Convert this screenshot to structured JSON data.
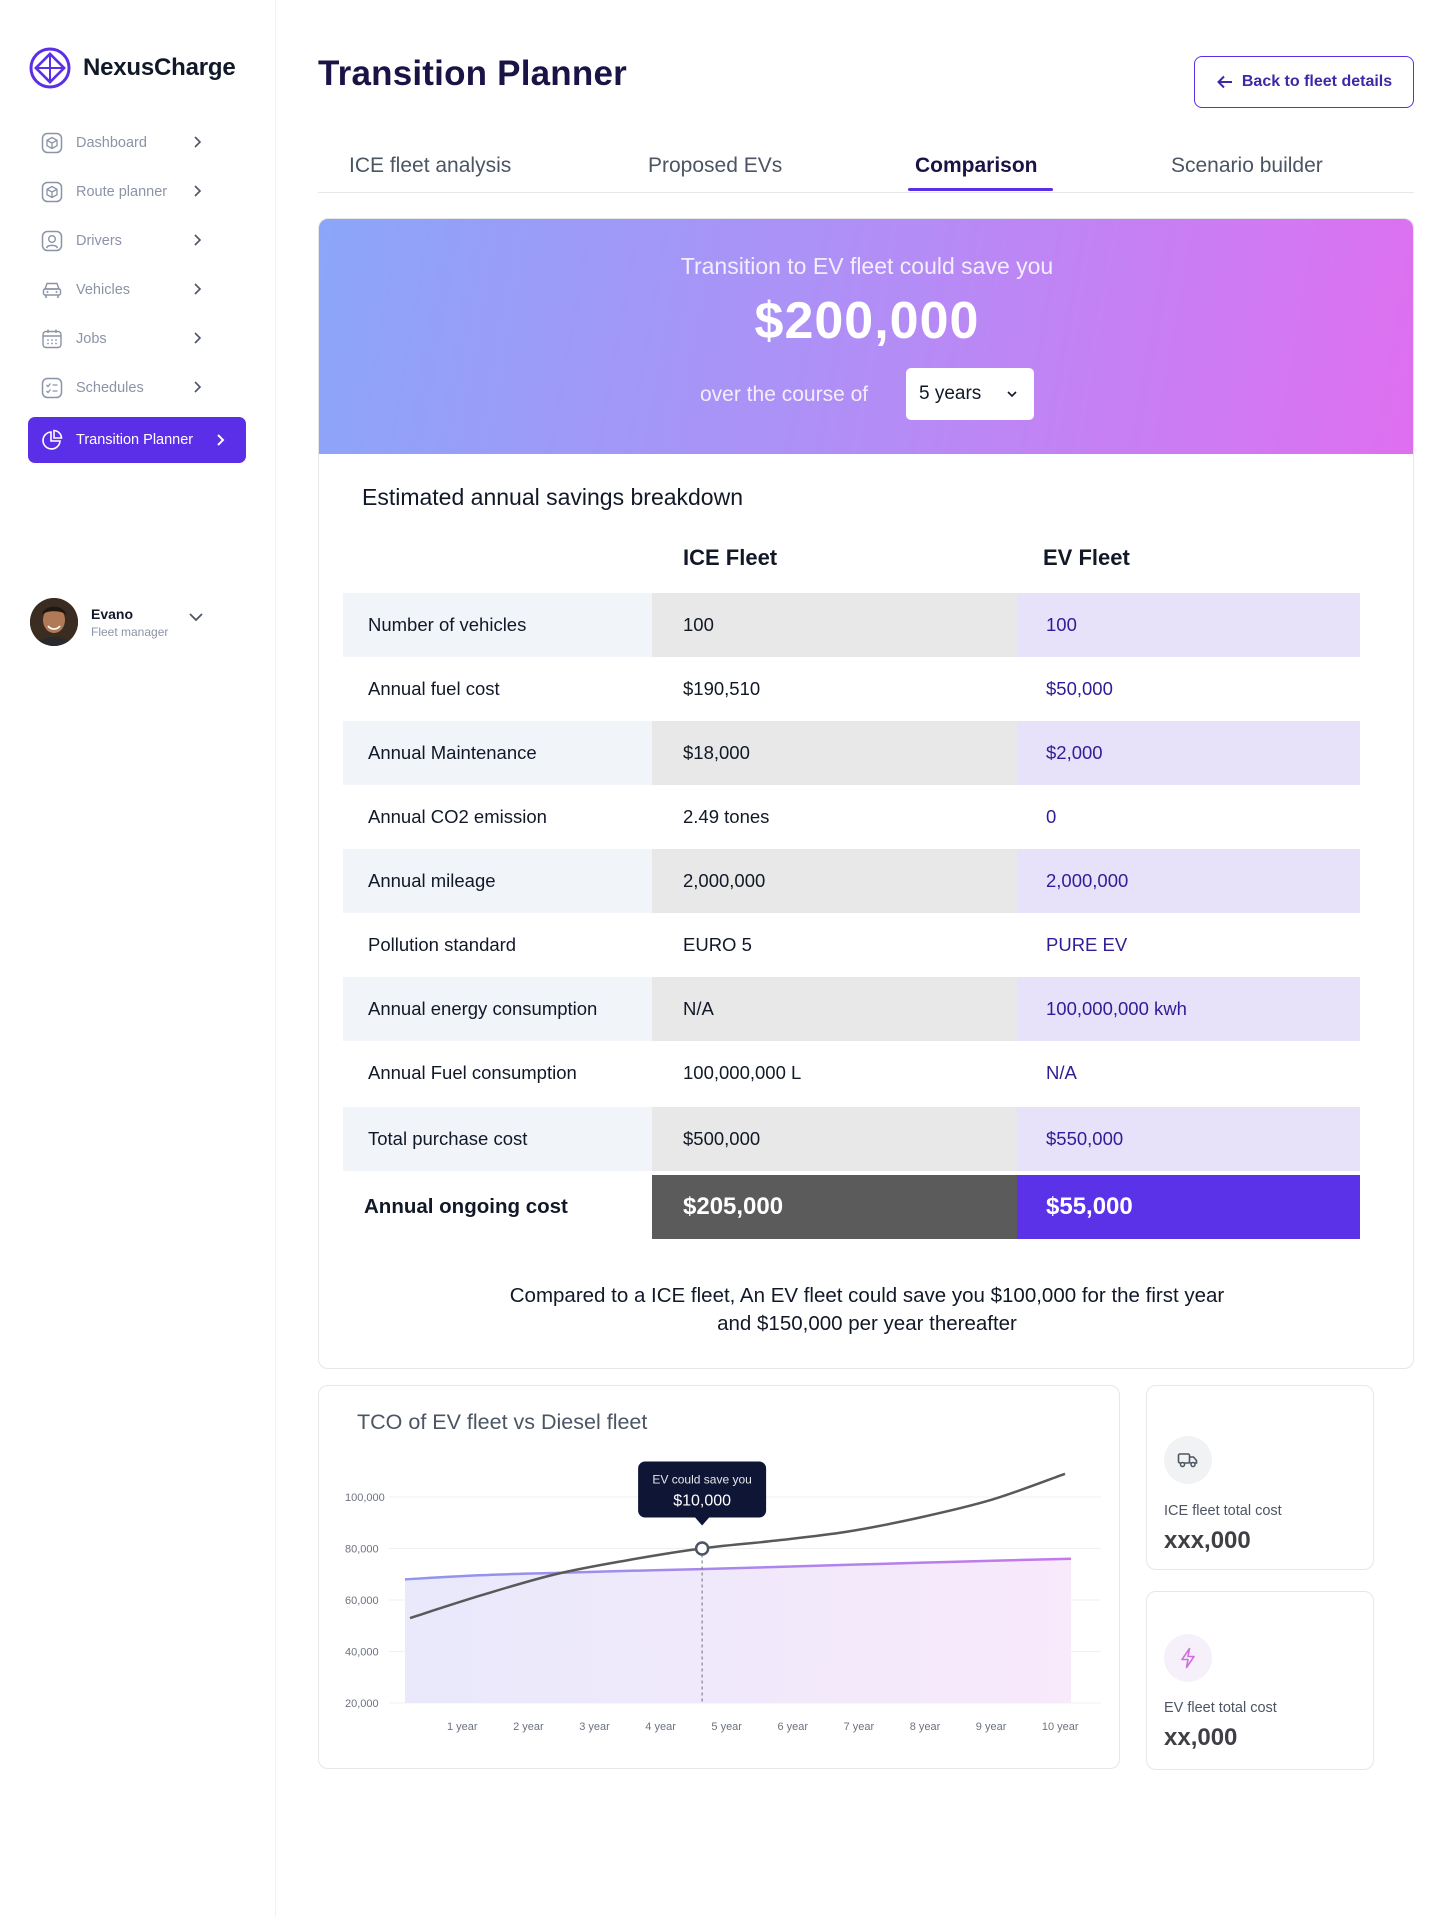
{
  "brand": {
    "name": "NexusCharge"
  },
  "sidebar": {
    "items": [
      {
        "label": "Dashboard",
        "icon": "cube-icon"
      },
      {
        "label": "Route planner",
        "icon": "route-icon"
      },
      {
        "label": "Drivers",
        "icon": "driver-icon"
      },
      {
        "label": "Vehicles",
        "icon": "car-icon"
      },
      {
        "label": "Jobs",
        "icon": "calendar-icon"
      },
      {
        "label": "Schedules",
        "icon": "schedule-icon"
      },
      {
        "label": "Transition Planner",
        "icon": "pie-chart-icon",
        "active": true
      }
    ]
  },
  "user": {
    "name": "Evano",
    "role": "Fleet manager"
  },
  "page": {
    "title": "Transition Planner",
    "back_label": "Back to fleet details"
  },
  "tabs": [
    {
      "label": "ICE fleet analysis"
    },
    {
      "label": "Proposed EVs"
    },
    {
      "label": "Comparison",
      "active": true
    },
    {
      "label": "Scenario builder"
    }
  ],
  "hero": {
    "subtitle": "Transition to EV fleet could save you",
    "amount": "$200,000",
    "course_label": "over the course of",
    "period": "5 years"
  },
  "breakdown": {
    "title": "Estimated annual savings breakdown",
    "col_ice": "ICE Fleet",
    "col_ev": "EV Fleet",
    "rows": [
      {
        "label": "Number of vehicles",
        "ice": "100",
        "ev": "100"
      },
      {
        "label": "Annual fuel cost",
        "ice": "$190,510",
        "ev": "$50,000"
      },
      {
        "label": "Annual Maintenance",
        "ice": "$18,000",
        "ev": "$2,000"
      },
      {
        "label": "Annual CO2 emission",
        "ice": "2.49 tones",
        "ev": "0"
      },
      {
        "label": "Annual mileage",
        "ice": "2,000,000",
        "ev": "2,000,000"
      },
      {
        "label": "Pollution standard",
        "ice": "EURO 5",
        "ev": "PURE EV"
      },
      {
        "label": "Annual energy consumption",
        "ice": "N/A",
        "ev": "100,000,000 kwh"
      },
      {
        "label": "Annual Fuel consumption",
        "ice": "100,000,000 L",
        "ev": "N/A"
      },
      {
        "label": "Total purchase cost",
        "ice": "$500,000",
        "ev": "$550,000"
      }
    ],
    "total": {
      "label": "Annual ongoing cost",
      "ice": "$205,000",
      "ev": "$55,000"
    },
    "note": "Compared to a ICE fleet, An EV fleet could save you $100,000 for the first year and $150,000 per year thereafter"
  },
  "chart_data": {
    "type": "line",
    "title": "TCO of EV fleet vs Diesel fleet",
    "categories": [
      "1 year",
      "2 year",
      "3 year",
      "4 year",
      "5 year",
      "6 year",
      "7 year",
      "8 year",
      "9 year",
      "10 year"
    ],
    "y_ticks": [
      "100,000",
      "80,000",
      "60,000",
      "40,000",
      "20,000"
    ],
    "ylim": [
      20000,
      100000
    ],
    "series": [
      {
        "values": [
          53000,
          62000,
          70000,
          75500,
          80000,
          83000,
          86500,
          92000,
          99000,
          109000
        ],
        "color": "#595959"
      },
      {
        "values": [
          68000,
          69600,
          70500,
          71300,
          72000,
          72800,
          73700,
          74500,
          75300,
          76000
        ],
        "color": "#a57ff0",
        "fill": true
      }
    ],
    "tooltip": {
      "category": "5 year",
      "title": "EV could save you",
      "value": "$10,000"
    },
    "grid": true
  },
  "cost_cards": [
    {
      "label": "ICE fleet total cost",
      "value": "xxx,000",
      "icon": "truck-icon",
      "icon_color": "#4b5563",
      "icon_bg": "#f1f2f4"
    },
    {
      "label": "EV fleet total cost",
      "value": "xx,000",
      "icon": "lightning-icon",
      "icon_color": "#d06fe0",
      "icon_bg": "#f6f0fb"
    }
  ]
}
